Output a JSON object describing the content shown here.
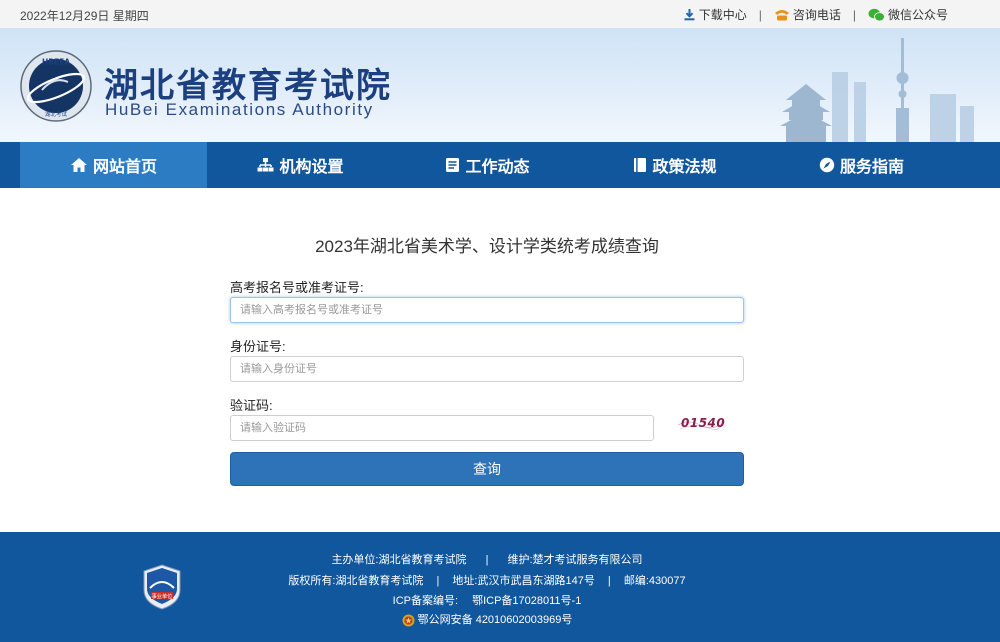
{
  "topbar": {
    "date": "2022年12月29日 星期四",
    "links": [
      {
        "label": "下载中心",
        "icon": "download-icon"
      },
      {
        "label": "咨询电话",
        "icon": "phone-icon"
      },
      {
        "label": "微信公众号",
        "icon": "wechat-icon"
      }
    ],
    "separator": "|"
  },
  "header": {
    "name_cn": "湖北省教育考试院",
    "name_en": "HuBei Examinations Authority",
    "emblem_text": "HBEEA",
    "emblem_sub": "湖北考试"
  },
  "nav": {
    "items": [
      {
        "label": "网站首页",
        "icon": "home-icon"
      },
      {
        "label": "机构设置",
        "icon": "org-chart-icon"
      },
      {
        "label": "工作动态",
        "icon": "document-icon"
      },
      {
        "label": "政策法规",
        "icon": "book-icon"
      },
      {
        "label": "服务指南",
        "icon": "compass-icon"
      }
    ]
  },
  "form": {
    "title": "2023年湖北省美术学、设计学类统考成绩查询",
    "exam_id_label": "高考报名号或准考证号:",
    "exam_id_placeholder": "请输入高考报名号或准考证号",
    "id_card_label": "身份证号:",
    "id_card_placeholder": "请输入身份证号",
    "captcha_label": "验证码:",
    "captcha_placeholder": "请输入验证码",
    "captcha_code": "01540",
    "submit_label": "查询"
  },
  "footer": {
    "host_label": "主办单位:",
    "host": "湖北省教育考试院",
    "maintain_label": "维护:",
    "maintain": "楚才考试服务有限公司",
    "copyright_label": "版权所有:",
    "copyright": "湖北省教育考试院",
    "address_label": "地址:",
    "address": "武汉市武昌东湖路147号",
    "zip_label": "邮编:",
    "zip": "430077",
    "icp_label": "ICP备案编号:",
    "icp": "鄂ICP备17028011号-1",
    "police": "鄂公网安备 42010602003969号",
    "badge_text": "事业单位"
  },
  "colors": {
    "nav_bg": "#11579e",
    "nav_active": "#2c7cc4",
    "button": "#2e73b7",
    "logo_text": "#1c3f80"
  }
}
